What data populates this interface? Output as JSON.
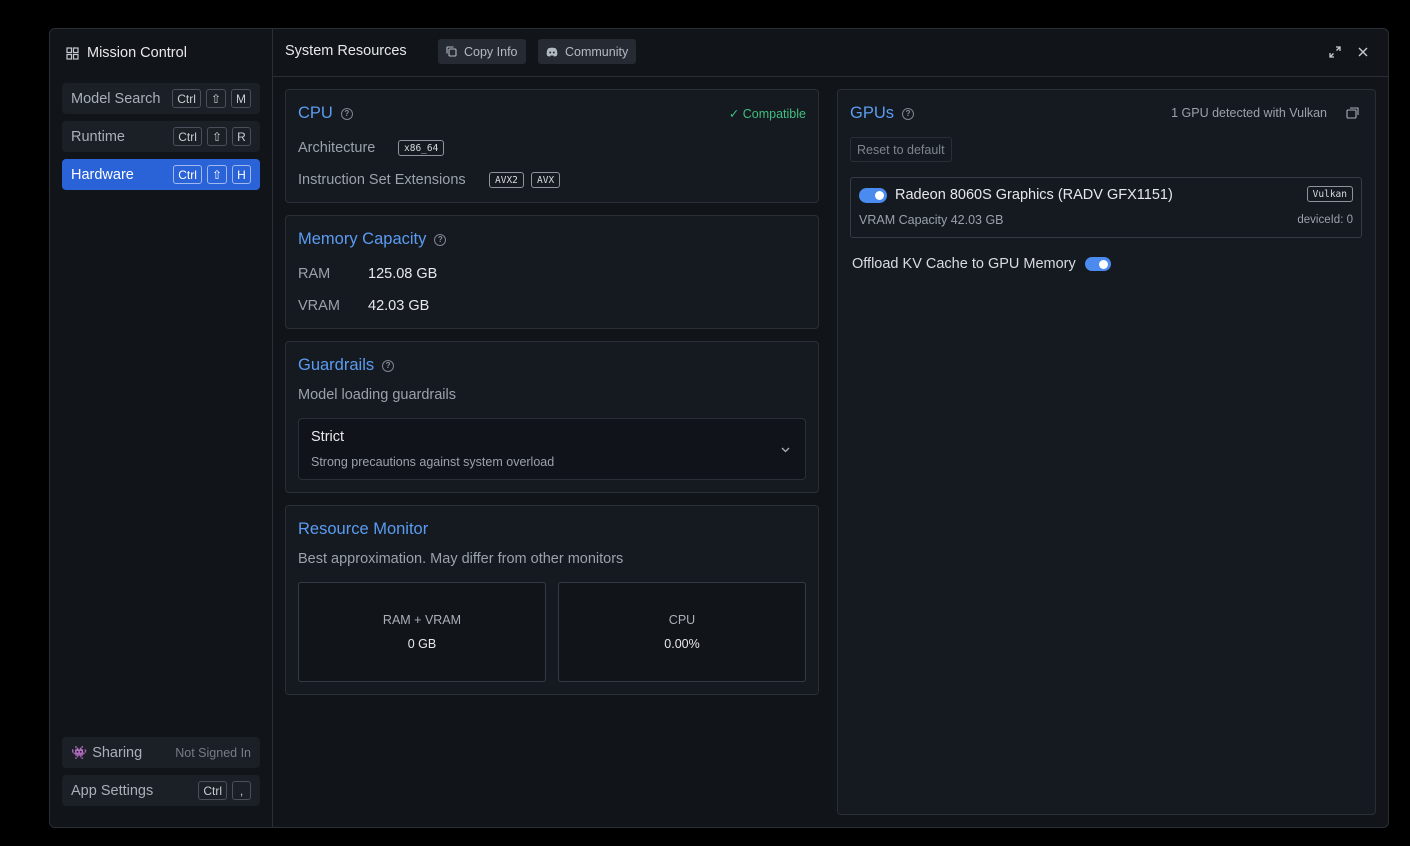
{
  "sidebar": {
    "title": "Mission Control",
    "items": [
      {
        "label": "Model Search",
        "keys": [
          "Ctrl",
          "⇧",
          "M"
        ]
      },
      {
        "label": "Runtime",
        "keys": [
          "Ctrl",
          "⇧",
          "R"
        ]
      },
      {
        "label": "Hardware",
        "keys": [
          "Ctrl",
          "⇧",
          "H"
        ]
      }
    ],
    "sharing": {
      "label": "Sharing",
      "status": "Not Signed In"
    },
    "app_settings": {
      "label": "App Settings",
      "keys": [
        "Ctrl",
        ","
      ]
    }
  },
  "header": {
    "title": "System Resources",
    "copy_info": "Copy Info",
    "community": "Community"
  },
  "cpu": {
    "title": "CPU",
    "status": "✓ Compatible",
    "architecture_label": "Architecture",
    "architecture_value": "x86_64",
    "extensions_label": "Instruction Set Extensions",
    "extensions": [
      "AVX2",
      "AVX"
    ]
  },
  "memory": {
    "title": "Memory Capacity",
    "ram_label": "RAM",
    "ram_value": "125.08 GB",
    "vram_label": "VRAM",
    "vram_value": "42.03 GB"
  },
  "guardrails": {
    "title": "Guardrails",
    "subtitle": "Model loading guardrails",
    "selected": "Strict",
    "selected_description": "Strong precautions against system overload"
  },
  "monitor": {
    "title": "Resource Monitor",
    "subtitle": "Best approximation. May differ from other monitors",
    "ram_label": "RAM + VRAM",
    "ram_value": "0 GB",
    "cpu_label": "CPU",
    "cpu_value": "0.00%"
  },
  "gpus": {
    "title": "GPUs",
    "detected": "1 GPU detected with Vulkan",
    "reset": "Reset to default",
    "gpu": {
      "name": "Radeon 8060S Graphics (RADV GFX1151)",
      "backend": "Vulkan",
      "vram": "VRAM Capacity 42.03 GB",
      "device_id": "deviceId: 0",
      "enabled": true
    },
    "offload_label": "Offload KV Cache to GPU Memory",
    "offload_enabled": true
  },
  "colors": {
    "accent": "#2a62d8",
    "link": "#5b9cf0",
    "success": "#3fbf7f",
    "toggle": "#4b8bef"
  }
}
